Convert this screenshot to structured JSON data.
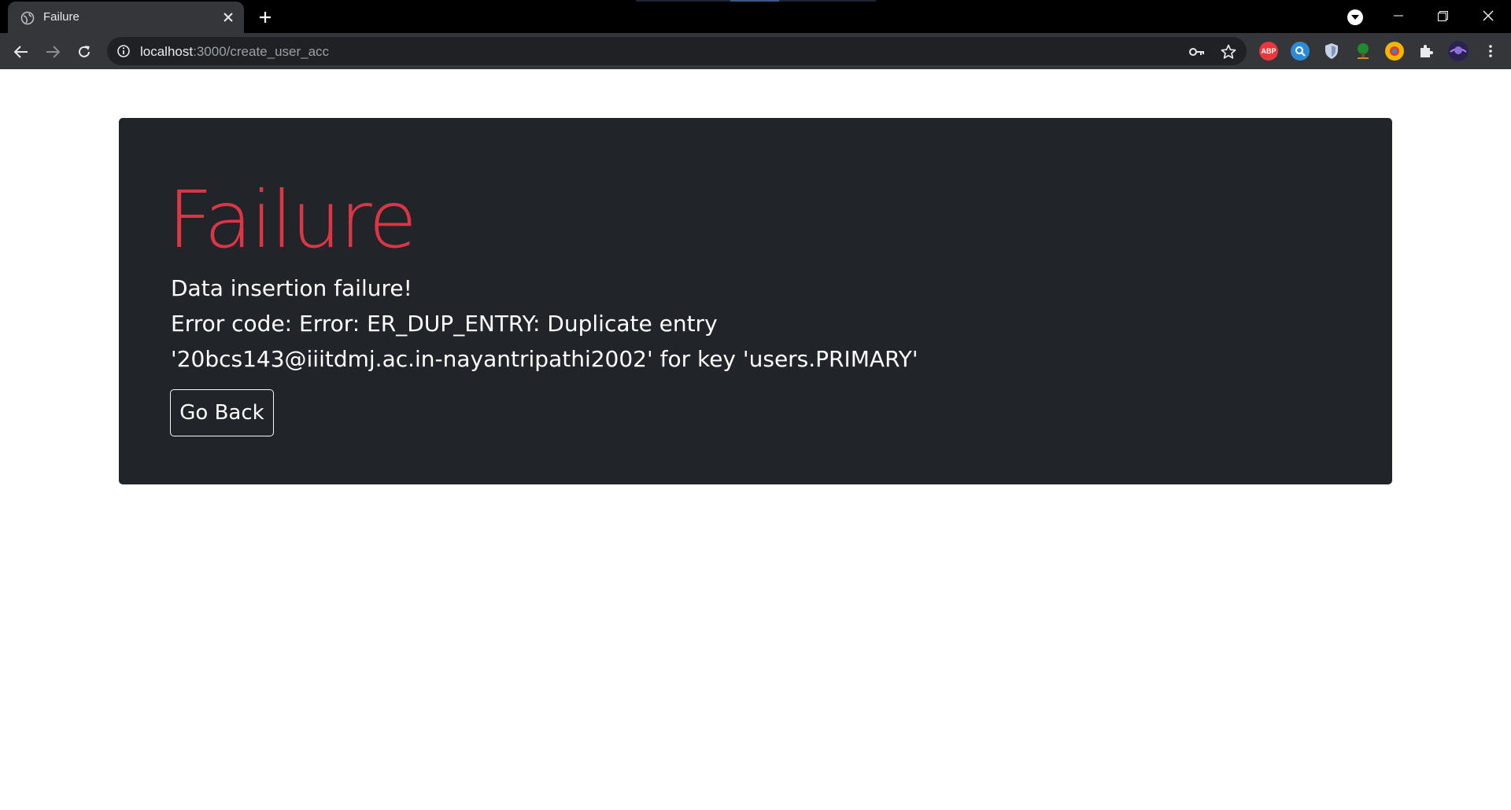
{
  "browser": {
    "tab": {
      "title": "Failure",
      "favicon": "globe-icon",
      "close_icon": "close-icon"
    },
    "new_tab_icon": "plus-icon",
    "window_controls": [
      "minimize-icon",
      "restore-icon",
      "close-icon"
    ],
    "address_bar": {
      "host": "localhost",
      "path": ":3000/create_user_acc"
    },
    "extensions": [
      {
        "name": "abp-icon",
        "label": "ABP",
        "color": "#e8383d"
      },
      {
        "name": "search-extension-icon",
        "color": "#2d8bd6"
      },
      {
        "name": "shield-icon",
        "color": "#c6d2e6"
      },
      {
        "name": "tree-icon",
        "color": "#1f8a2e"
      },
      {
        "name": "chrome-style-icon",
        "color": "#f2b500"
      },
      {
        "name": "puzzle-icon",
        "color": "#e8eaed"
      },
      {
        "name": "avatar",
        "color": "#4b3a8a"
      },
      {
        "name": "kebab-menu-icon",
        "color": "#e8eaed"
      }
    ]
  },
  "page": {
    "heading": "Failure",
    "message_line1": "Data insertion failure!",
    "message_line2": "Error code: Error: ER_DUP_ENTRY: Duplicate entry '20bcs143@iiitdmj.ac.in-nayantripathi2002' for key 'users.PRIMARY'",
    "back_button": "Go Back"
  },
  "colors": {
    "accent_danger": "#dc3545",
    "jumbotron_bg": "#212529",
    "chrome_dark": "#35363a"
  }
}
